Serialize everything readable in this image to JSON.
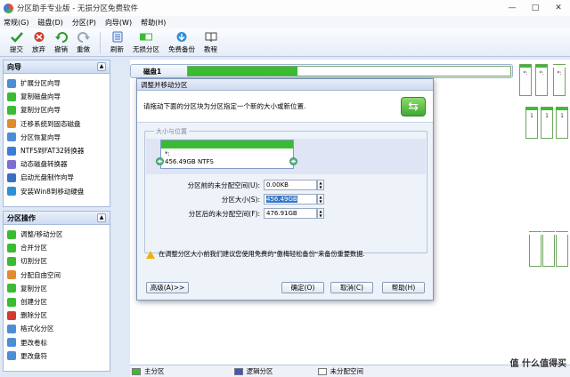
{
  "window": {
    "title": "分区助手专业版 - 无损分区免费软件",
    "controls": [
      "—",
      "□",
      "✕"
    ]
  },
  "menu": [
    "常规(G)",
    "磁盘(D)",
    "分区(P)",
    "向导(W)",
    "帮助(H)"
  ],
  "toolbar": {
    "buttons": [
      {
        "label": "提交",
        "icon": "check-icon",
        "color": "#2e9a2e"
      },
      {
        "label": "放弃",
        "icon": "discard-icon",
        "color": "#d03b2e"
      },
      {
        "label": "撤销",
        "icon": "undo-icon",
        "color": "#2e9a2e"
      },
      {
        "label": "重做",
        "icon": "redo-icon",
        "color": "#9aa6b6"
      },
      {
        "label": "刷新",
        "icon": "refresh-icon",
        "color": "#3b6fc6"
      },
      {
        "label": "无损分区",
        "icon": "partition-icon",
        "color": "#3bbb34"
      },
      {
        "label": "免费备份",
        "icon": "backup-icon",
        "color": "#2f8fd8"
      },
      {
        "label": "教程",
        "icon": "tutorial-icon",
        "color": "#444444"
      }
    ]
  },
  "sidebar": {
    "wizard": {
      "title": "向导",
      "items": [
        "扩展分区向导",
        "复制磁盘向导",
        "复制分区向导",
        "迁移系统到固态磁盘",
        "分区恢复向导",
        "NTFS到FAT32转换器",
        "动态磁盘转换器",
        "启动光盘制作向导",
        "安装Win8到移动硬盘"
      ]
    },
    "ops": {
      "title": "分区操作",
      "items": [
        "调整/移动分区",
        "合并分区",
        "切割分区",
        "分配自由空间",
        "复制分区",
        "创建分区",
        "删除分区",
        "格式化分区",
        "更改卷标",
        "更改盘符"
      ]
    }
  },
  "disk": {
    "label": "磁盘1",
    "fill_fraction": 0.34,
    "mini_labels": [
      "*:",
      "1",
      "1"
    ]
  },
  "dialog": {
    "title": "调整并移动分区",
    "description": "请拖动下面的分区块为分区指定一个新的大小或新位置.",
    "group_label": "大小与位置",
    "partition": {
      "name": "*:",
      "info": "456.49GB NTFS"
    },
    "fields": [
      {
        "label": "分区前的未分配空间(U):",
        "value": "0.00KB",
        "selected": false
      },
      {
        "label": "分区大小(S):",
        "value": "456.49GB",
        "selected": true
      },
      {
        "label": "分区后的未分配空间(F):",
        "value": "476.91GB",
        "selected": false
      }
    ],
    "warning": "在调整分区大小前我们建议您使用免费的\"傲梅轻松备份\"来备份重要数据.",
    "buttons": {
      "advanced": "高级(A)>>",
      "ok": "确定(O)",
      "cancel": "取消(C)",
      "help": "帮助(H)"
    }
  },
  "legend": [
    {
      "label": "主分区",
      "color": "#3bbb34"
    },
    {
      "label": "逻辑分区",
      "color": "#3e56c8"
    },
    {
      "label": "未分配空间",
      "color": "#ffffff"
    }
  ],
  "watermark": "值 什么值得买"
}
